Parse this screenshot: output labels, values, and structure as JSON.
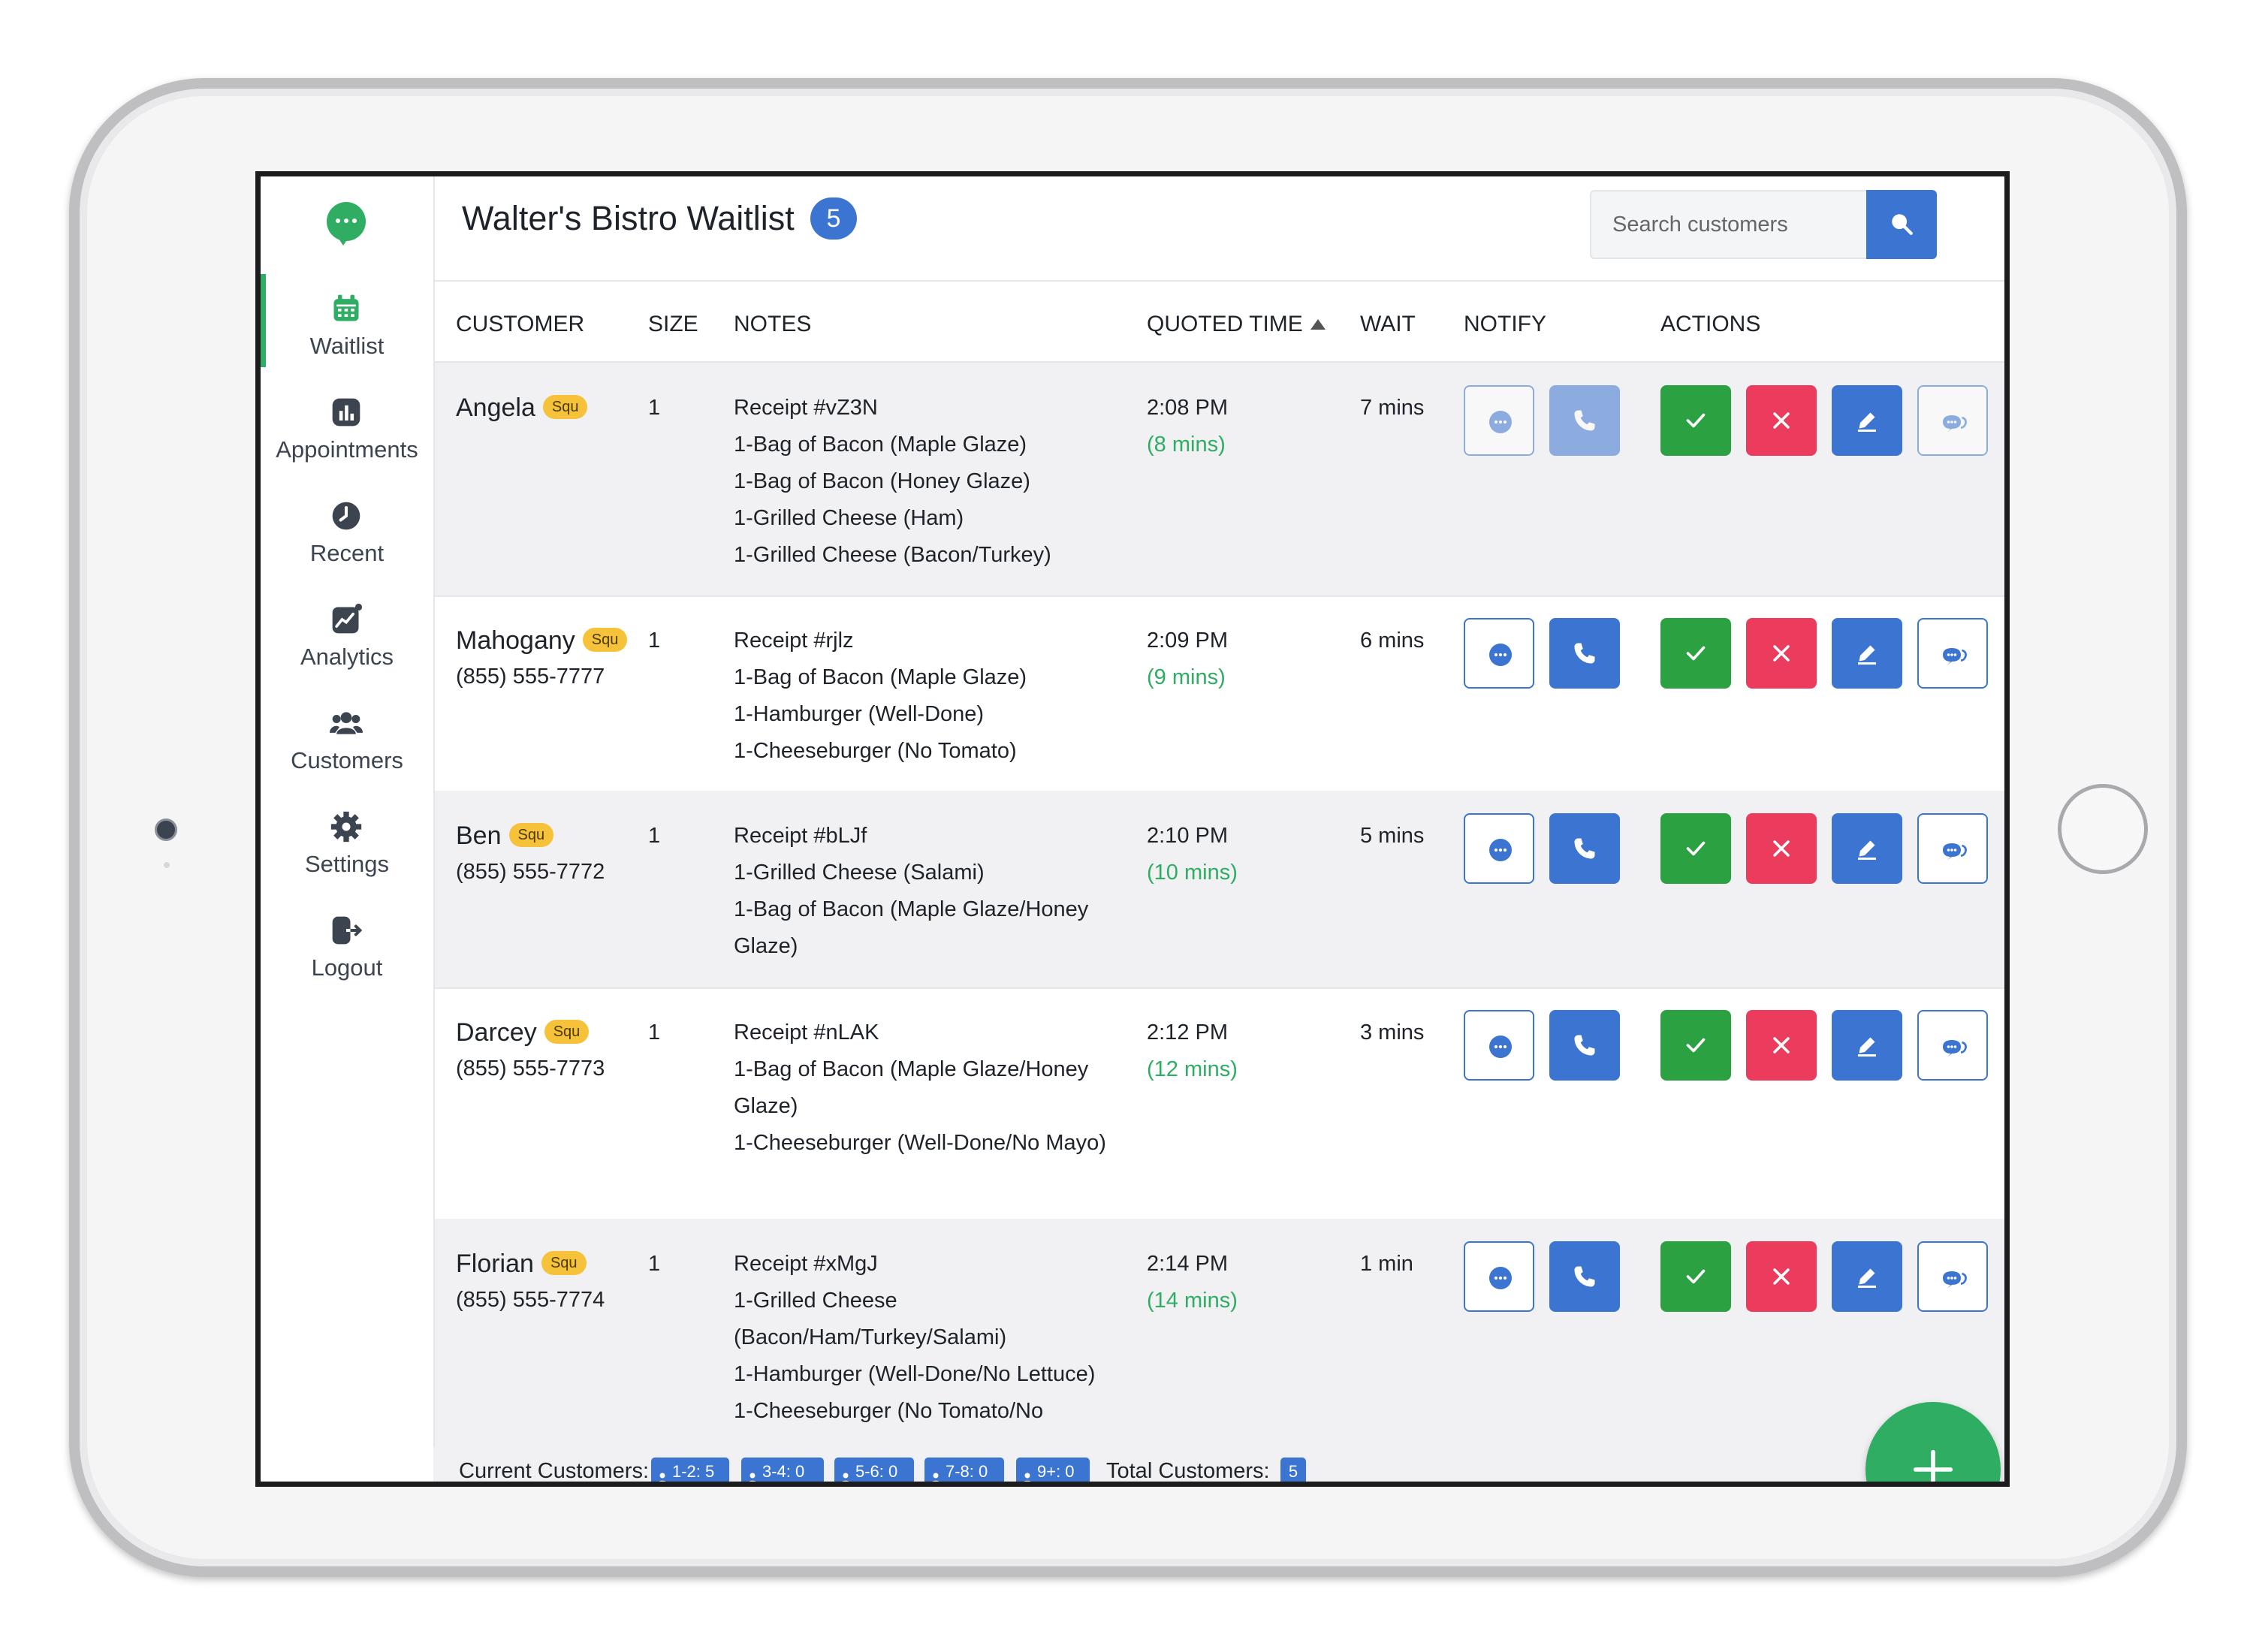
{
  "app": {
    "title": "Walter's Bistro Waitlist",
    "waitlist_count": "5",
    "search_placeholder": "Search customers"
  },
  "colors": {
    "accent": "#3b74d1",
    "brand": "#2ead63",
    "success": "#2ba142",
    "danger": "#ec3c5e",
    "tag": "#f6c23a"
  },
  "sidebar": {
    "items": [
      {
        "label": "Waitlist",
        "icon": "calendar-icon",
        "active": true
      },
      {
        "label": "Appointments",
        "icon": "bar-chart-icon"
      },
      {
        "label": "Recent",
        "icon": "clock-icon"
      },
      {
        "label": "Analytics",
        "icon": "trend-chart-icon"
      },
      {
        "label": "Customers",
        "icon": "users-icon"
      },
      {
        "label": "Settings",
        "icon": "gear-icon"
      },
      {
        "label": "Logout",
        "icon": "logout-icon"
      }
    ]
  },
  "table": {
    "headers": {
      "customer": "CUSTOMER",
      "size": "SIZE",
      "notes": "NOTES",
      "quoted": "QUOTED TIME",
      "wait": "WAIT",
      "notify": "NOTIFY",
      "actions": "ACTIONS"
    },
    "rows": [
      {
        "name": "Angela",
        "tag": "Squ",
        "phone": "",
        "size": "1",
        "notes": [
          "Receipt #vZ3N",
          "1-Bag of Bacon (Maple Glaze)",
          "1-Bag of Bacon (Honey Glaze)",
          "1-Grilled Cheese (Ham)",
          "1-Grilled Cheese (Bacon/Turkey)"
        ],
        "quoted": "2:08 PM",
        "quoted_mins": "(8 mins)",
        "wait": "7 mins"
      },
      {
        "name": "Mahogany",
        "tag": "Squ",
        "phone": "(855) 555-7777",
        "size": "1",
        "notes": [
          "Receipt #rjlz",
          "1-Bag of Bacon (Maple Glaze)",
          "1-Hamburger (Well-Done)",
          "1-Cheeseburger (No Tomato)"
        ],
        "quoted": "2:09 PM",
        "quoted_mins": "(9 mins)",
        "wait": "6 mins"
      },
      {
        "name": "Ben",
        "tag": "Squ",
        "phone": "(855) 555-7772",
        "size": "1",
        "notes": [
          "Receipt #bLJf",
          "1-Grilled Cheese (Salami)",
          "1-Bag of Bacon (Maple Glaze/Honey Glaze)"
        ],
        "quoted": "2:10 PM",
        "quoted_mins": "(10 mins)",
        "wait": "5 mins"
      },
      {
        "name": "Darcey",
        "tag": "Squ",
        "phone": "(855) 555-7773",
        "size": "1",
        "notes": [
          "Receipt #nLAK",
          "1-Bag of Bacon (Maple Glaze/Honey Glaze)",
          "1-Cheeseburger (Well-Done/No Mayo)"
        ],
        "quoted": "2:12 PM",
        "quoted_mins": "(12 mins)",
        "wait": "3 mins"
      },
      {
        "name": "Florian",
        "tag": "Squ",
        "phone": "(855) 555-7774",
        "size": "1",
        "notes": [
          "Receipt #xMgJ",
          "1-Grilled Cheese (Bacon/Ham/Turkey/Salami)",
          "1-Hamburger (Well-Done/No Lettuce)",
          "1-Cheeseburger (No Tomato/No"
        ],
        "quoted": "2:14 PM",
        "quoted_mins": "(14 mins)",
        "wait": "1 min"
      }
    ]
  },
  "footer": {
    "current_label": "Current Customers:",
    "groups": [
      "1-2: 5",
      "3-4: 0",
      "5-6: 0",
      "7-8: 0",
      "9+: 0"
    ],
    "total_label": "Total Customers:",
    "total": "5"
  }
}
